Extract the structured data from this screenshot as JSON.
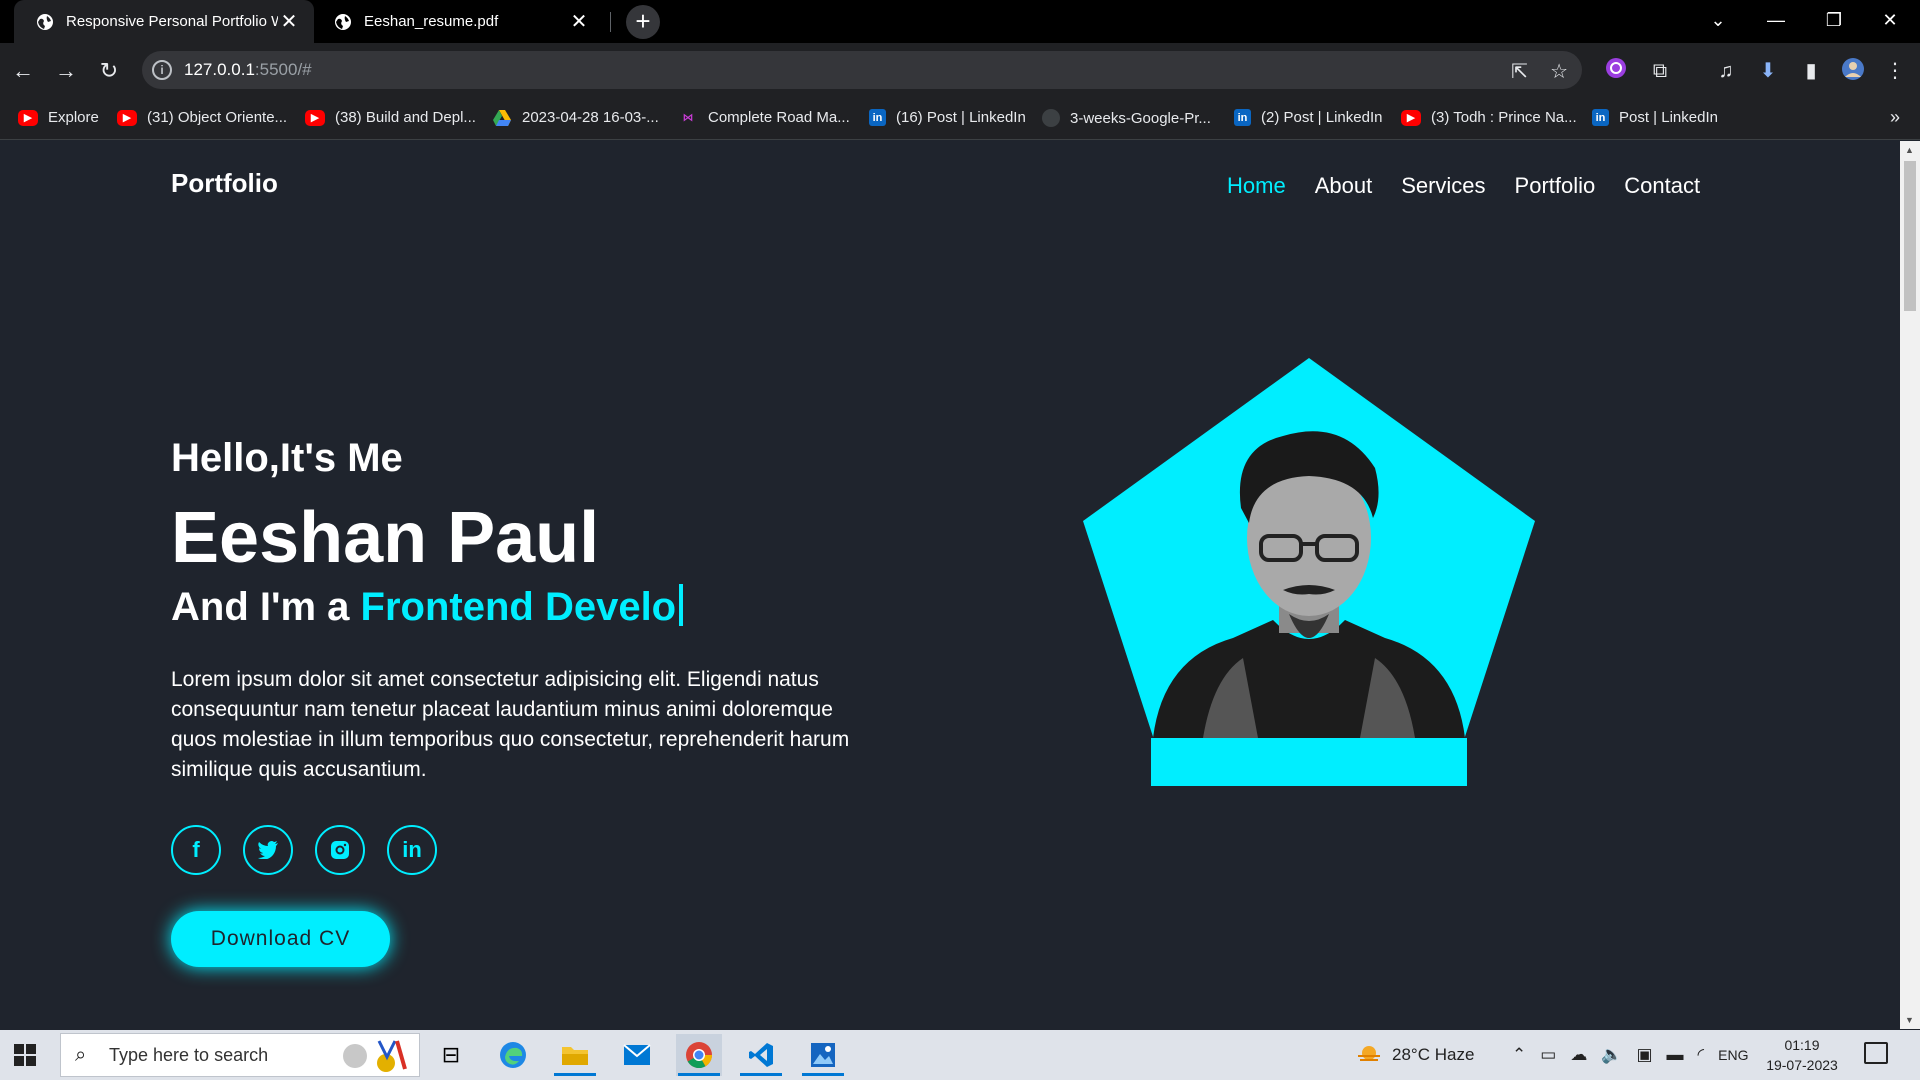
{
  "browser": {
    "tabs": [
      {
        "title": "Responsive Personal Portfolio W",
        "active": true
      },
      {
        "title": "Eeshan_resume.pdf",
        "active": false
      }
    ],
    "url_host": "127.0.0.1",
    "url_rest": ":5500/#",
    "bookmarks": [
      {
        "label": "Explore",
        "icon": "youtube-icon"
      },
      {
        "label": "(31) Object Oriente...",
        "icon": "youtube-icon"
      },
      {
        "label": "(38) Build and Depl...",
        "icon": "youtube-icon"
      },
      {
        "label": "2023-04-28 16-03-...",
        "icon": "google-drive-icon"
      },
      {
        "label": "Complete Road Ma...",
        "icon": "roadmap-icon"
      },
      {
        "label": "(16) Post | LinkedIn",
        "icon": "linkedin-icon"
      },
      {
        "label": "3-weeks-Google-Pr...",
        "icon": "github-icon"
      },
      {
        "label": "(2) Post | LinkedIn",
        "icon": "linkedin-icon"
      },
      {
        "label": "(3) Todh : Prince Na...",
        "icon": "youtube-icon"
      },
      {
        "label": "Post | LinkedIn",
        "icon": "linkedin-icon"
      }
    ],
    "more_bookmarks": "»"
  },
  "site": {
    "logo": "Portfolio",
    "nav": [
      "Home",
      "About",
      "Services",
      "Portfolio",
      "Contact"
    ],
    "active_nav": "Home",
    "hello": "Hello,It's Me",
    "name": "Eeshan Paul",
    "role_prefix": "And I'm a ",
    "role_typed": "Frontend Develo",
    "lead": "Lorem ipsum dolor sit amet consectetur adipisicing elit. Eligendi natus consequuntur nam tenetur placeat laudantium minus animi doloremque quos molestiae in illum temporibus quo consectetur, reprehenderit harum similique quis accusantium.",
    "socials": [
      {
        "name": "facebook-icon",
        "glyph": "f"
      },
      {
        "name": "twitter-icon",
        "glyph": "🐦"
      },
      {
        "name": "instagram-icon",
        "glyph": "◎"
      },
      {
        "name": "linkedin-icon",
        "glyph": "in"
      }
    ],
    "cta": "Download CV",
    "accent_color": "#00eeff",
    "background_color": "#1f242d"
  },
  "taskbar": {
    "search_placeholder": "Type here to search",
    "weather": "28°C  Haze",
    "language": "ENG",
    "time": "01:19",
    "date": "19-07-2023"
  }
}
